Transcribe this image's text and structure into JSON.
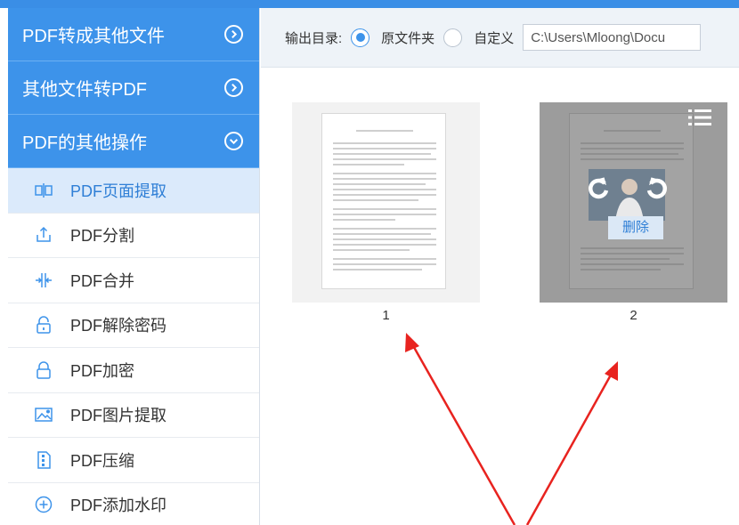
{
  "colors": {
    "accent": "#3d93ea",
    "arrow": "#e8231f"
  },
  "sidebar": {
    "categories": [
      {
        "label": "PDF转成其他文件",
        "icon": "chevron-right-circle-icon"
      },
      {
        "label": "其他文件转PDF",
        "icon": "chevron-right-circle-icon"
      },
      {
        "label": "PDF的其他操作",
        "icon": "chevron-down-circle-icon"
      }
    ],
    "items": [
      {
        "label": "PDF页面提取",
        "icon": "page-extract-icon",
        "active": true
      },
      {
        "label": "PDF分割",
        "icon": "split-icon"
      },
      {
        "label": "PDF合并",
        "icon": "merge-icon"
      },
      {
        "label": "PDF解除密码",
        "icon": "unlock-icon"
      },
      {
        "label": "PDF加密",
        "icon": "lock-icon"
      },
      {
        "label": "PDF图片提取",
        "icon": "image-extract-icon"
      },
      {
        "label": "PDF压缩",
        "icon": "compress-icon"
      },
      {
        "label": "PDF添加水印",
        "icon": "add-watermark-icon"
      }
    ]
  },
  "toolbar": {
    "output_label": "输出目录:",
    "option_source": "原文件夹",
    "option_custom": "自定义",
    "selected": "原文件夹",
    "path_value": "C:\\Users\\Mloong\\Docu"
  },
  "pages": [
    {
      "number": "1"
    },
    {
      "number": "2",
      "delete_label": "删除"
    }
  ]
}
